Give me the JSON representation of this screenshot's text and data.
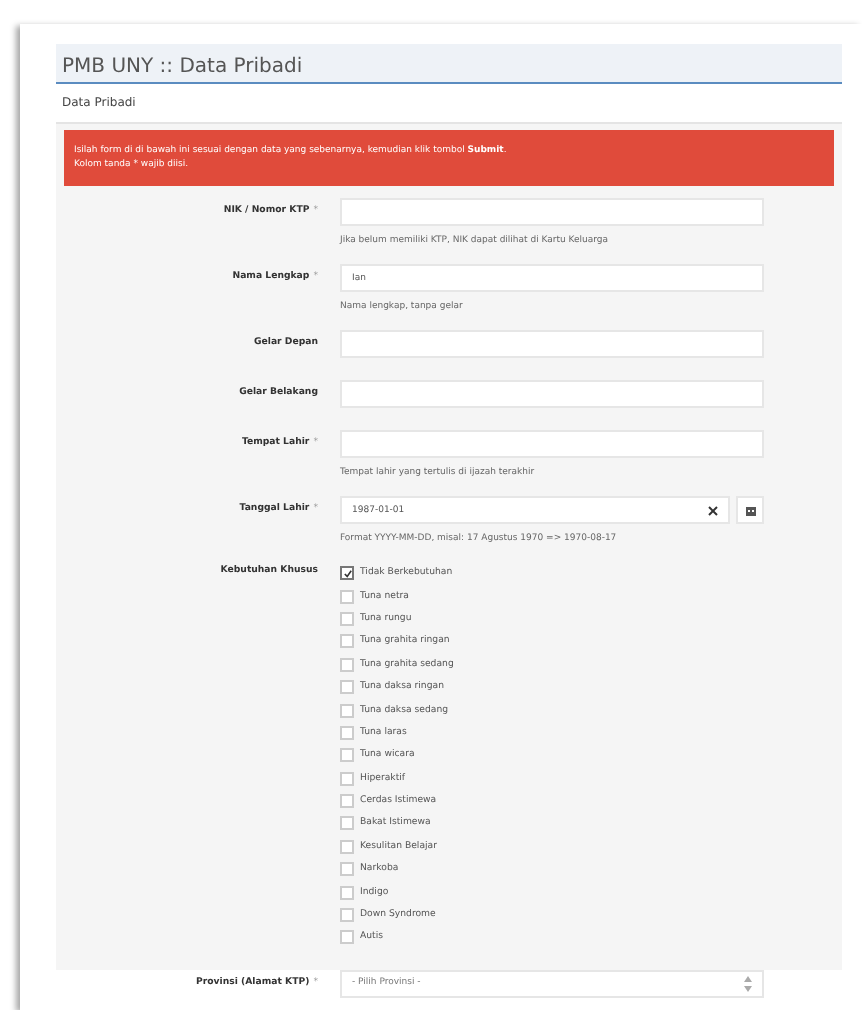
{
  "page_title": "PMB UNY :: Data Pribadi",
  "tab": {
    "label": "Data Pribadi"
  },
  "alert": {
    "lines": [
      "Isilah form di di bawah ini sesuai dengan data yang sebenarnya, kemudian klik tombol **Submit**.",
      "Kolom tanda * wajib diisi."
    ]
  },
  "fields": [
    {
      "kind": "text",
      "label": "NIK / Nomor KTP",
      "required_mark": "*",
      "help": "Jika belum memiliki KTP, NIK dapat dilihat di Kartu Keluarga"
    },
    {
      "kind": "text",
      "label": "Nama Lengkap",
      "required_mark": "*",
      "value": "Ian",
      "help": "Nama lengkap, tanpa gelar"
    },
    {
      "kind": "text",
      "label": "Gelar Depan"
    },
    {
      "kind": "text",
      "label": "Gelar Belakang"
    },
    {
      "kind": "text",
      "label": "Tempat Lahir",
      "required_mark": "*",
      "help": "Tempat lahir yang tertulis di ijazah terakhir"
    },
    {
      "kind": "date",
      "label": "Tanggal Lahir",
      "required_mark": "*",
      "value": "1987-01-01",
      "help": "Format YYYY-MM-DD, misal: 17 Agustus 1970 => 1970-08-17"
    },
    {
      "kind": "checks",
      "label": "Kebutuhan Khusus",
      "options": [
        {
          "label": "Tidak Berkebutuhan",
          "checked": true
        },
        {
          "label": "Tuna netra",
          "checked": false
        },
        {
          "label": "Tuna rungu",
          "checked": false
        },
        {
          "label": "Tuna grahita ringan",
          "checked": false
        },
        {
          "label": "Tuna grahita sedang",
          "checked": false
        },
        {
          "label": "Tuna daksa ringan",
          "checked": false
        },
        {
          "label": "Tuna daksa sedang",
          "checked": false
        },
        {
          "label": "Tuna laras",
          "checked": false
        },
        {
          "label": "Tuna wicara",
          "checked": false
        },
        {
          "label": "Hiperaktif",
          "checked": false
        },
        {
          "label": "Cerdas Istimewa",
          "checked": false
        },
        {
          "label": "Bakat Istimewa",
          "checked": false
        },
        {
          "label": "Kesulitan Belajar",
          "checked": false
        },
        {
          "label": "Narkoba",
          "checked": false
        },
        {
          "label": "Indigo",
          "checked": false
        },
        {
          "label": "Down Syndrome",
          "checked": false
        },
        {
          "label": "Autis",
          "checked": false
        }
      ]
    },
    {
      "kind": "select",
      "label": "Provinsi (Alamat KTP)",
      "required_mark": "*",
      "placeholder": "- Pilih Provinsi -"
    }
  ]
}
